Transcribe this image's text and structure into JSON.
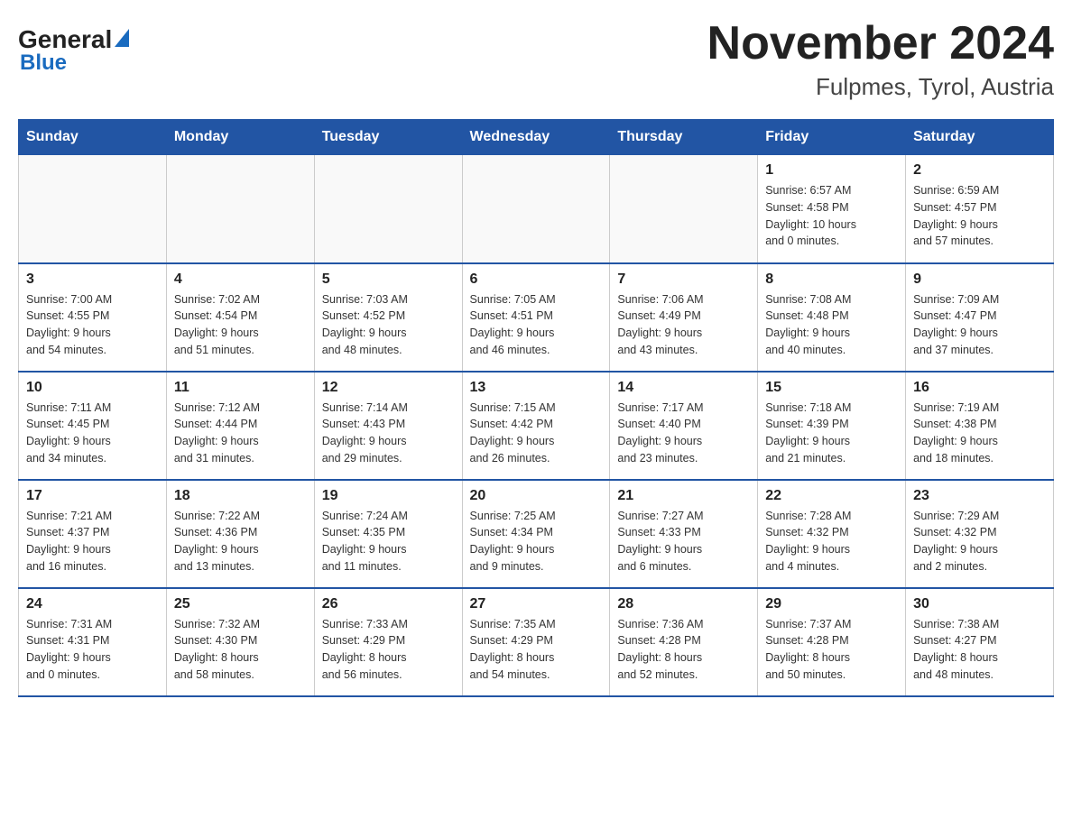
{
  "logo": {
    "part1": "General",
    "triangle": "▶",
    "part2": "Blue"
  },
  "title": "November 2024",
  "subtitle": "Fulpmes, Tyrol, Austria",
  "days_of_week": [
    "Sunday",
    "Monday",
    "Tuesday",
    "Wednesday",
    "Thursday",
    "Friday",
    "Saturday"
  ],
  "weeks": [
    [
      {
        "day": "",
        "info": ""
      },
      {
        "day": "",
        "info": ""
      },
      {
        "day": "",
        "info": ""
      },
      {
        "day": "",
        "info": ""
      },
      {
        "day": "",
        "info": ""
      },
      {
        "day": "1",
        "info": "Sunrise: 6:57 AM\nSunset: 4:58 PM\nDaylight: 10 hours\nand 0 minutes."
      },
      {
        "day": "2",
        "info": "Sunrise: 6:59 AM\nSunset: 4:57 PM\nDaylight: 9 hours\nand 57 minutes."
      }
    ],
    [
      {
        "day": "3",
        "info": "Sunrise: 7:00 AM\nSunset: 4:55 PM\nDaylight: 9 hours\nand 54 minutes."
      },
      {
        "day": "4",
        "info": "Sunrise: 7:02 AM\nSunset: 4:54 PM\nDaylight: 9 hours\nand 51 minutes."
      },
      {
        "day": "5",
        "info": "Sunrise: 7:03 AM\nSunset: 4:52 PM\nDaylight: 9 hours\nand 48 minutes."
      },
      {
        "day": "6",
        "info": "Sunrise: 7:05 AM\nSunset: 4:51 PM\nDaylight: 9 hours\nand 46 minutes."
      },
      {
        "day": "7",
        "info": "Sunrise: 7:06 AM\nSunset: 4:49 PM\nDaylight: 9 hours\nand 43 minutes."
      },
      {
        "day": "8",
        "info": "Sunrise: 7:08 AM\nSunset: 4:48 PM\nDaylight: 9 hours\nand 40 minutes."
      },
      {
        "day": "9",
        "info": "Sunrise: 7:09 AM\nSunset: 4:47 PM\nDaylight: 9 hours\nand 37 minutes."
      }
    ],
    [
      {
        "day": "10",
        "info": "Sunrise: 7:11 AM\nSunset: 4:45 PM\nDaylight: 9 hours\nand 34 minutes."
      },
      {
        "day": "11",
        "info": "Sunrise: 7:12 AM\nSunset: 4:44 PM\nDaylight: 9 hours\nand 31 minutes."
      },
      {
        "day": "12",
        "info": "Sunrise: 7:14 AM\nSunset: 4:43 PM\nDaylight: 9 hours\nand 29 minutes."
      },
      {
        "day": "13",
        "info": "Sunrise: 7:15 AM\nSunset: 4:42 PM\nDaylight: 9 hours\nand 26 minutes."
      },
      {
        "day": "14",
        "info": "Sunrise: 7:17 AM\nSunset: 4:40 PM\nDaylight: 9 hours\nand 23 minutes."
      },
      {
        "day": "15",
        "info": "Sunrise: 7:18 AM\nSunset: 4:39 PM\nDaylight: 9 hours\nand 21 minutes."
      },
      {
        "day": "16",
        "info": "Sunrise: 7:19 AM\nSunset: 4:38 PM\nDaylight: 9 hours\nand 18 minutes."
      }
    ],
    [
      {
        "day": "17",
        "info": "Sunrise: 7:21 AM\nSunset: 4:37 PM\nDaylight: 9 hours\nand 16 minutes."
      },
      {
        "day": "18",
        "info": "Sunrise: 7:22 AM\nSunset: 4:36 PM\nDaylight: 9 hours\nand 13 minutes."
      },
      {
        "day": "19",
        "info": "Sunrise: 7:24 AM\nSunset: 4:35 PM\nDaylight: 9 hours\nand 11 minutes."
      },
      {
        "day": "20",
        "info": "Sunrise: 7:25 AM\nSunset: 4:34 PM\nDaylight: 9 hours\nand 9 minutes."
      },
      {
        "day": "21",
        "info": "Sunrise: 7:27 AM\nSunset: 4:33 PM\nDaylight: 9 hours\nand 6 minutes."
      },
      {
        "day": "22",
        "info": "Sunrise: 7:28 AM\nSunset: 4:32 PM\nDaylight: 9 hours\nand 4 minutes."
      },
      {
        "day": "23",
        "info": "Sunrise: 7:29 AM\nSunset: 4:32 PM\nDaylight: 9 hours\nand 2 minutes."
      }
    ],
    [
      {
        "day": "24",
        "info": "Sunrise: 7:31 AM\nSunset: 4:31 PM\nDaylight: 9 hours\nand 0 minutes."
      },
      {
        "day": "25",
        "info": "Sunrise: 7:32 AM\nSunset: 4:30 PM\nDaylight: 8 hours\nand 58 minutes."
      },
      {
        "day": "26",
        "info": "Sunrise: 7:33 AM\nSunset: 4:29 PM\nDaylight: 8 hours\nand 56 minutes."
      },
      {
        "day": "27",
        "info": "Sunrise: 7:35 AM\nSunset: 4:29 PM\nDaylight: 8 hours\nand 54 minutes."
      },
      {
        "day": "28",
        "info": "Sunrise: 7:36 AM\nSunset: 4:28 PM\nDaylight: 8 hours\nand 52 minutes."
      },
      {
        "day": "29",
        "info": "Sunrise: 7:37 AM\nSunset: 4:28 PM\nDaylight: 8 hours\nand 50 minutes."
      },
      {
        "day": "30",
        "info": "Sunrise: 7:38 AM\nSunset: 4:27 PM\nDaylight: 8 hours\nand 48 minutes."
      }
    ]
  ]
}
